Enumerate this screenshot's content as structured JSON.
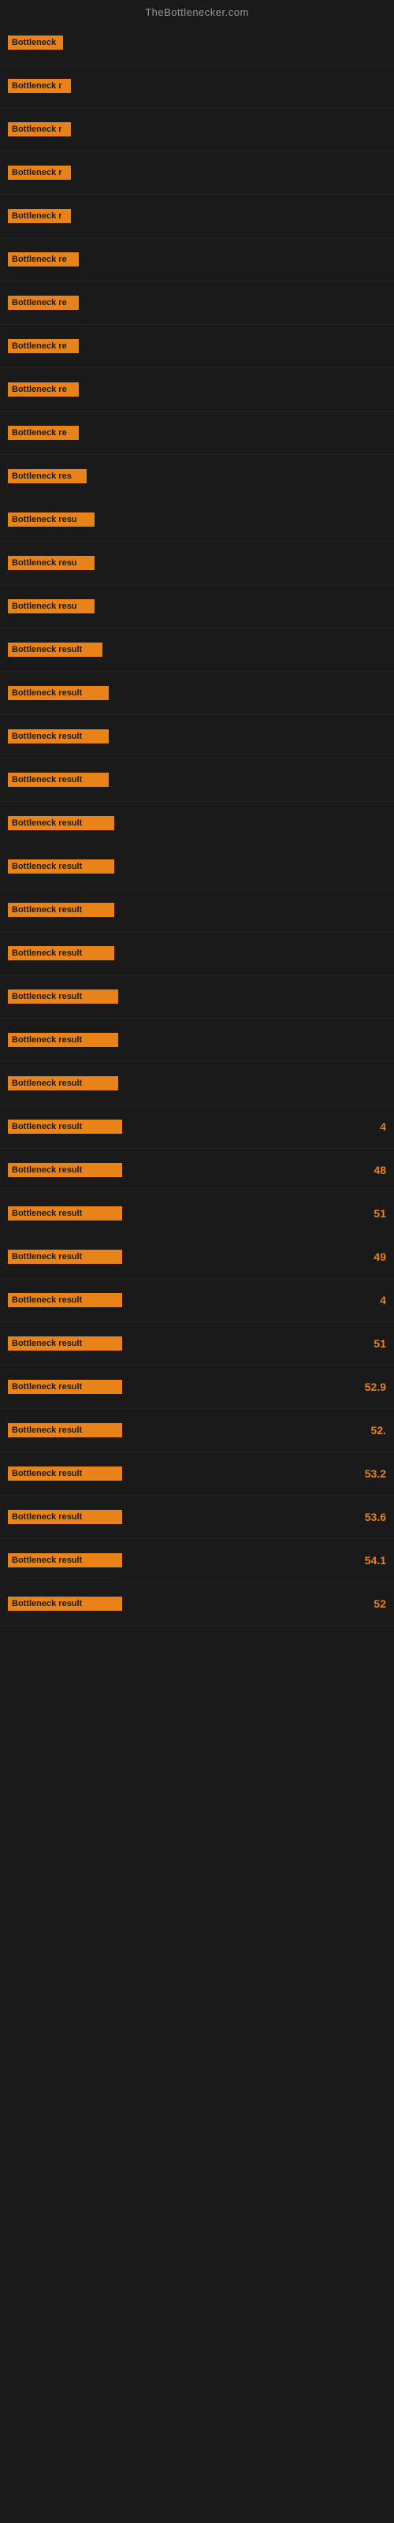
{
  "site": {
    "title": "TheBottlenecker.com"
  },
  "rows": [
    {
      "label": "Bottleneck",
      "label_width": 70,
      "value": ""
    },
    {
      "label": "Bottleneck r",
      "label_width": 80,
      "value": ""
    },
    {
      "label": "Bottleneck r",
      "label_width": 80,
      "value": ""
    },
    {
      "label": "Bottleneck r",
      "label_width": 80,
      "value": ""
    },
    {
      "label": "Bottleneck r",
      "label_width": 80,
      "value": ""
    },
    {
      "label": "Bottleneck re",
      "label_width": 90,
      "value": ""
    },
    {
      "label": "Bottleneck re",
      "label_width": 90,
      "value": ""
    },
    {
      "label": "Bottleneck re",
      "label_width": 90,
      "value": ""
    },
    {
      "label": "Bottleneck re",
      "label_width": 90,
      "value": ""
    },
    {
      "label": "Bottleneck re",
      "label_width": 90,
      "value": ""
    },
    {
      "label": "Bottleneck res",
      "label_width": 100,
      "value": ""
    },
    {
      "label": "Bottleneck resu",
      "label_width": 110,
      "value": ""
    },
    {
      "label": "Bottleneck resu",
      "label_width": 110,
      "value": ""
    },
    {
      "label": "Bottleneck resu",
      "label_width": 110,
      "value": ""
    },
    {
      "label": "Bottleneck result",
      "label_width": 120,
      "value": ""
    },
    {
      "label": "Bottleneck result",
      "label_width": 128,
      "value": ""
    },
    {
      "label": "Bottleneck result",
      "label_width": 128,
      "value": ""
    },
    {
      "label": "Bottleneck result",
      "label_width": 128,
      "value": ""
    },
    {
      "label": "Bottleneck result",
      "label_width": 135,
      "value": ""
    },
    {
      "label": "Bottleneck result",
      "label_width": 135,
      "value": ""
    },
    {
      "label": "Bottleneck result",
      "label_width": 135,
      "value": ""
    },
    {
      "label": "Bottleneck result",
      "label_width": 135,
      "value": ""
    },
    {
      "label": "Bottleneck result",
      "label_width": 140,
      "value": ""
    },
    {
      "label": "Bottleneck result",
      "label_width": 140,
      "value": ""
    },
    {
      "label": "Bottleneck result",
      "label_width": 140,
      "value": ""
    },
    {
      "label": "Bottleneck result",
      "label_width": 145,
      "value": "4"
    },
    {
      "label": "Bottleneck result",
      "label_width": 145,
      "value": "48"
    },
    {
      "label": "Bottleneck result",
      "label_width": 145,
      "value": "51"
    },
    {
      "label": "Bottleneck result",
      "label_width": 145,
      "value": "49"
    },
    {
      "label": "Bottleneck result",
      "label_width": 145,
      "value": "4"
    },
    {
      "label": "Bottleneck result",
      "label_width": 145,
      "value": "51"
    },
    {
      "label": "Bottleneck result",
      "label_width": 145,
      "value": "52.9"
    },
    {
      "label": "Bottleneck result",
      "label_width": 145,
      "value": "52."
    },
    {
      "label": "Bottleneck result",
      "label_width": 145,
      "value": "53.2"
    },
    {
      "label": "Bottleneck result",
      "label_width": 145,
      "value": "53.6"
    },
    {
      "label": "Bottleneck result",
      "label_width": 145,
      "value": "54.1"
    },
    {
      "label": "Bottleneck result",
      "label_width": 145,
      "value": "52"
    }
  ]
}
